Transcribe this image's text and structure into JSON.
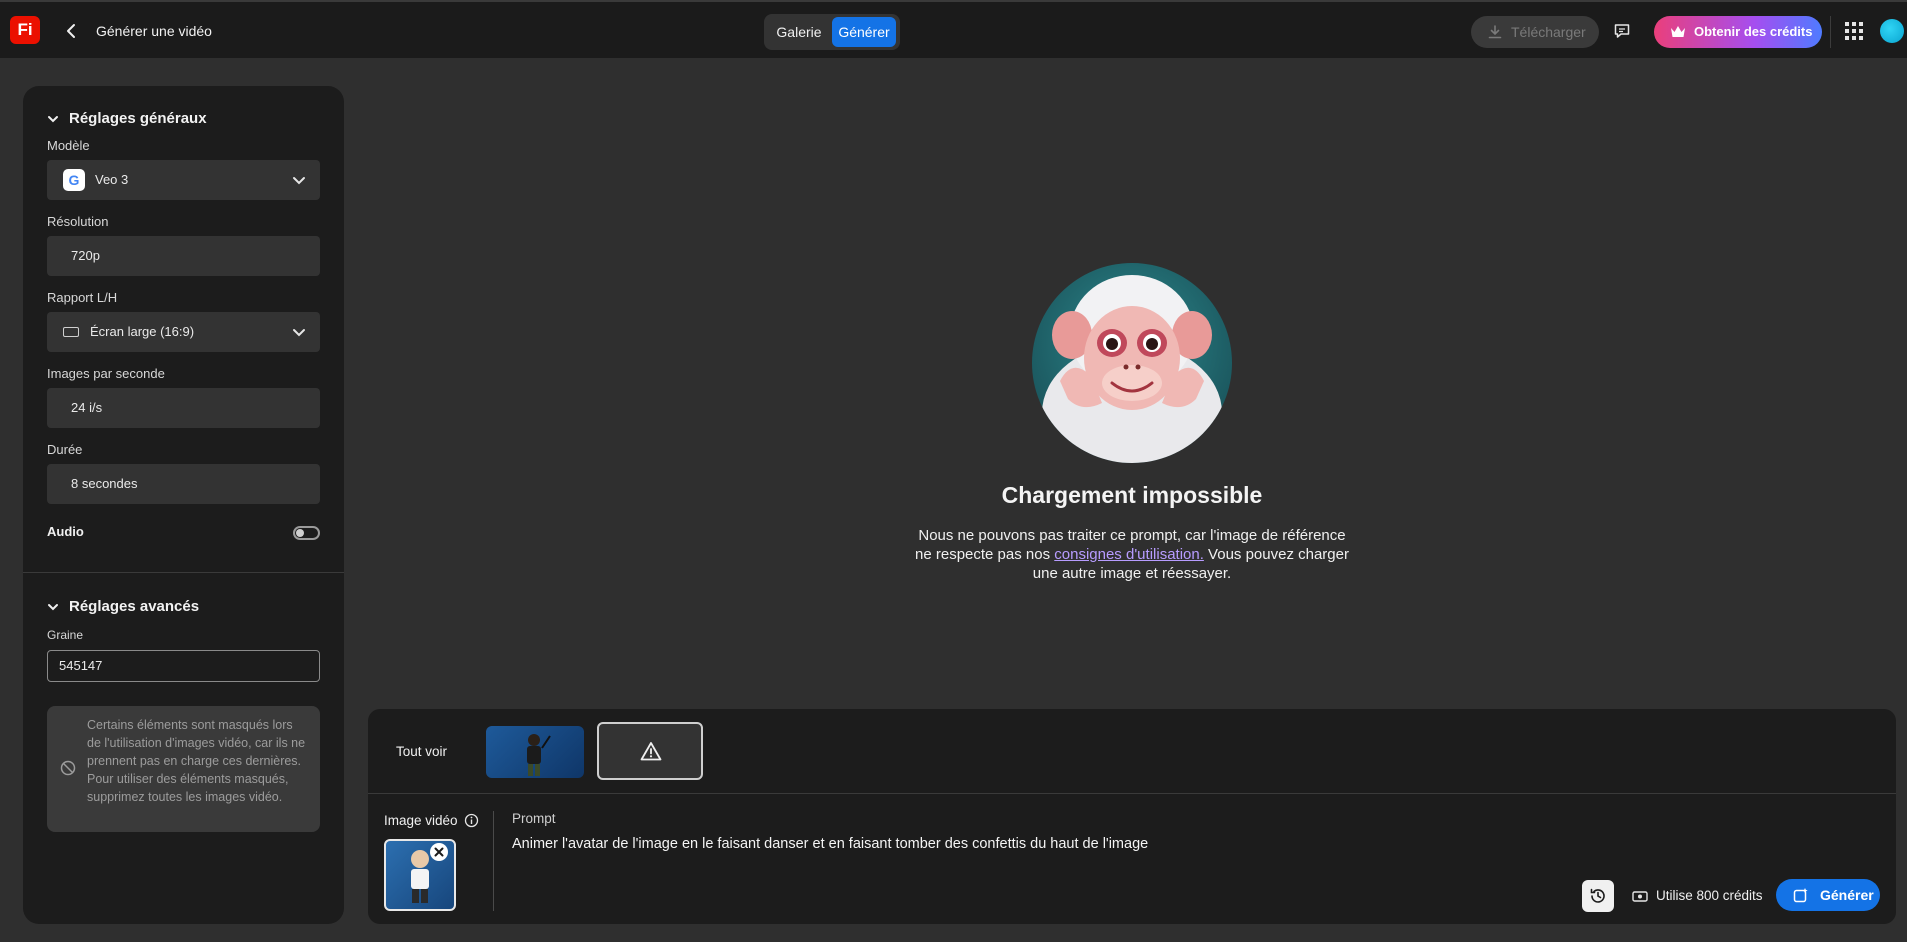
{
  "header": {
    "logo": "Fi",
    "page_title": "Générer une vidéo",
    "tabs": [
      {
        "label": "Galerie",
        "active": false
      },
      {
        "label": "Générer",
        "active": true
      }
    ],
    "download_label": "Télécharger",
    "credits_label": "Obtenir des crédits"
  },
  "sidebar": {
    "general": {
      "title": "Réglages généraux",
      "model_label": "Modèle",
      "model_value": "Veo 3",
      "resolution_label": "Résolution",
      "resolution_value": "720p",
      "ratio_label": "Rapport L/H",
      "ratio_value": "Écran large (16:9)",
      "fps_label": "Images par seconde",
      "fps_value": "24 i/s",
      "duration_label": "Durée",
      "duration_value": "8 secondes",
      "audio_label": "Audio",
      "audio_on": false
    },
    "advanced": {
      "title": "Réglages avancés",
      "seed_label": "Graine",
      "seed_value": "545147",
      "note": "Certains éléments sont masqués lors de l'utilisation d'images vidéo, car ils ne prennent pas en charge ces dernières. Pour utiliser des éléments masqués, supprimez toutes les images vidéo."
    }
  },
  "main": {
    "error_title": "Chargement impossible",
    "error_msg_before": "Nous ne pouvons pas traiter ce prompt, car l'image de référence ne respecte pas nos ",
    "error_link": "consignes d'utilisation.",
    "error_msg_after": " Vous pouvez charger une autre image et réessayer."
  },
  "composer": {
    "see_all": "Tout voir",
    "image_label": "Image vidéo",
    "prompt_label": "Prompt",
    "prompt_text": "Animer l'avatar de l'image en le faisant danser et en faisant tomber des confettis du haut de l'image",
    "cost_label": "Utilise 800 crédits",
    "generate_label": "Générer"
  },
  "colors": {
    "accent": "#1473e6",
    "logo_red": "#eb1000",
    "link": "#b79cff"
  }
}
